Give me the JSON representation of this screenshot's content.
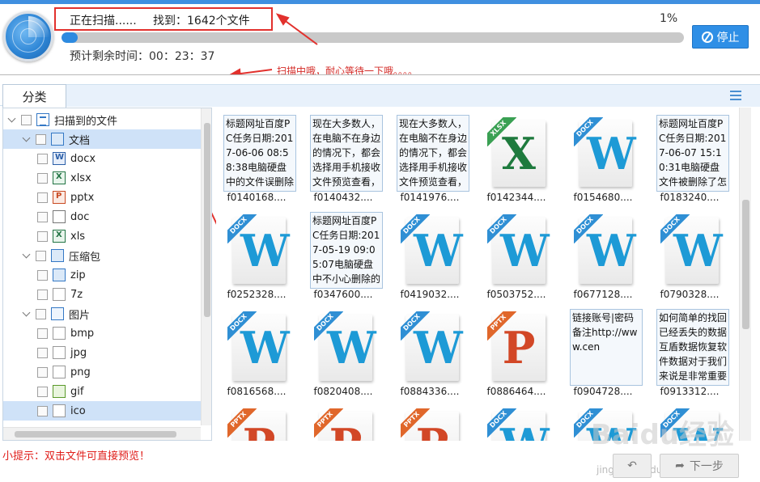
{
  "header": {
    "status": "正在扫描......",
    "found": "找到：1642个文件",
    "percent_text": "1%",
    "progress": 0.01,
    "remaining": "预计剩余时间：00：23：37",
    "stop_label": "停止",
    "annotation": "扫描中哦，耐心等待一下哦。。。。"
  },
  "tabs": {
    "active": "分类"
  },
  "tree": {
    "items": [
      {
        "label": "扫描到的文件",
        "icon": "list-icon",
        "level": 0,
        "expanded": true
      },
      {
        "label": "文档",
        "icon": "document-folder-icon",
        "level": 1,
        "expanded": true,
        "selected": true
      },
      {
        "label": "docx",
        "icon": "docx-icon",
        "level": 2
      },
      {
        "label": "xlsx",
        "icon": "xlsx-icon",
        "level": 2
      },
      {
        "label": "pptx",
        "icon": "pptx-icon",
        "level": 2
      },
      {
        "label": "doc",
        "icon": "doc-icon",
        "level": 2
      },
      {
        "label": "xls",
        "icon": "xls-icon",
        "level": 2
      },
      {
        "label": "压缩包",
        "icon": "archive-folder-icon",
        "level": 1,
        "expanded": true
      },
      {
        "label": "zip",
        "icon": "zip-icon",
        "level": 2
      },
      {
        "label": "7z",
        "icon": "file-icon",
        "level": 2
      },
      {
        "label": "图片",
        "icon": "image-folder-icon",
        "level": 1,
        "expanded": true
      },
      {
        "label": "bmp",
        "icon": "file-icon",
        "level": 2
      },
      {
        "label": "jpg",
        "icon": "file-icon",
        "level": 2
      },
      {
        "label": "png",
        "icon": "file-icon",
        "level": 2
      },
      {
        "label": "gif",
        "icon": "gif-icon",
        "level": 2
      },
      {
        "label": "ico",
        "icon": "file-icon",
        "level": 2,
        "selected": true
      }
    ]
  },
  "files": [
    {
      "name": "f0140168....",
      "type": "text",
      "preview": "标题网址百度PC任务日期:2017-06-06 08:58:38电脑硬盘中的文件误删除怎么恢"
    },
    {
      "name": "f0140432....",
      "type": "text",
      "preview": "现在大多数人，在电脑不在身边的情况下，都会选择用手机接收文件预览查看，所以手机对"
    },
    {
      "name": "f0141976....",
      "type": "text",
      "preview": "现在大多数人，在电脑不在身边的情况下，都会选择用手机接收文件预览查看，所以手机对"
    },
    {
      "name": "f0142344....",
      "type": "xlsx"
    },
    {
      "name": "f0154680....",
      "type": "docx"
    },
    {
      "name": "f0183240....",
      "type": "text",
      "preview": "标题网址百度PC任务日期:2017-06-07 15:10:31电脑硬盘文件被删除了怎么找"
    },
    {
      "name": "f0252328....",
      "type": "docx"
    },
    {
      "name": "f0347600....",
      "type": "text",
      "preview": "标题网址百度PC任务日期:2017-05-19 09:05:07电脑硬盘中不小心删除的文件"
    },
    {
      "name": "f0419032....",
      "type": "docx"
    },
    {
      "name": "f0503752....",
      "type": "docx"
    },
    {
      "name": "f0677128....",
      "type": "docx"
    },
    {
      "name": "f0790328....",
      "type": "docx"
    },
    {
      "name": "f0816568....",
      "type": "docx"
    },
    {
      "name": "f0820408....",
      "type": "docx"
    },
    {
      "name": "f0884336....",
      "type": "docx"
    },
    {
      "name": "f0886464....",
      "type": "pptx"
    },
    {
      "name": "f0904728....",
      "type": "text",
      "preview": "链接账号|密码备注http://www.cen"
    },
    {
      "name": "f0913312....",
      "type": "text",
      "preview": "如何简单的找回已经丢失的数据互盾数据恢复软件数据对于我们来说是非常重要"
    },
    {
      "name": "",
      "type": "pptx"
    },
    {
      "name": "",
      "type": "pptx"
    },
    {
      "name": "",
      "type": "pptx"
    },
    {
      "name": "",
      "type": "docx"
    },
    {
      "name": "",
      "type": "docx"
    },
    {
      "name": "",
      "type": "docx"
    }
  ],
  "ribbon_labels": {
    "docx": "DOCX",
    "xlsx": "XLSX",
    "pptx": "PPTX"
  },
  "letters": {
    "docx": "W",
    "xlsx": "X",
    "pptx": "P"
  },
  "footer": {
    "tip": "小提示：双击文件可直接预览！",
    "back_label": "↶",
    "next_label": "下一步"
  },
  "watermark": {
    "text": "Baidu经验",
    "sub": "jingyan.baidu.com"
  },
  "colors": {
    "accent": "#2f8fe6",
    "annotation": "#d42b27",
    "highlight": "#e2312d"
  }
}
